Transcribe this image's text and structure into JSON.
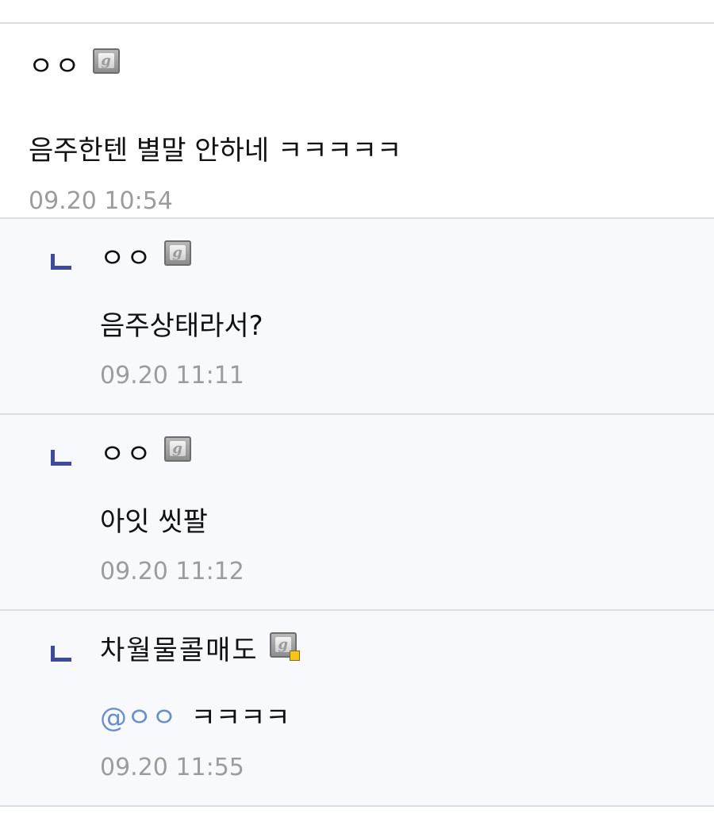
{
  "comments": [
    {
      "author": "ㅇㅇ",
      "badge_icon": "fixed-nickname-badge-icon",
      "text": "음주한텐 별말 안하네 ㅋㅋㅋㅋㅋ",
      "time": "09.20 10:54"
    },
    {
      "author": "ㅇㅇ",
      "badge_icon": "fixed-nickname-badge-icon",
      "text": "음주상태라서?",
      "time": "09.20 11:11"
    },
    {
      "author": "ㅇㅇ",
      "badge_icon": "fixed-nickname-badge-icon",
      "text": "아잇 씻팔",
      "time": "09.20 11:12"
    },
    {
      "author": "차월물콜매도",
      "badge_icon": "fixed-nickname-badge-manager-icon",
      "mention": "@ㅇㅇ",
      "text": "ㅋㅋㅋㅋ",
      "time": "09.20 11:55"
    }
  ],
  "badge_glyph": "g",
  "colors": {
    "reply_marker": "#3e4b9c",
    "mention": "#6a8ec8",
    "timestamp": "#9c9c9c",
    "reply_background": "#f8f9fc"
  }
}
